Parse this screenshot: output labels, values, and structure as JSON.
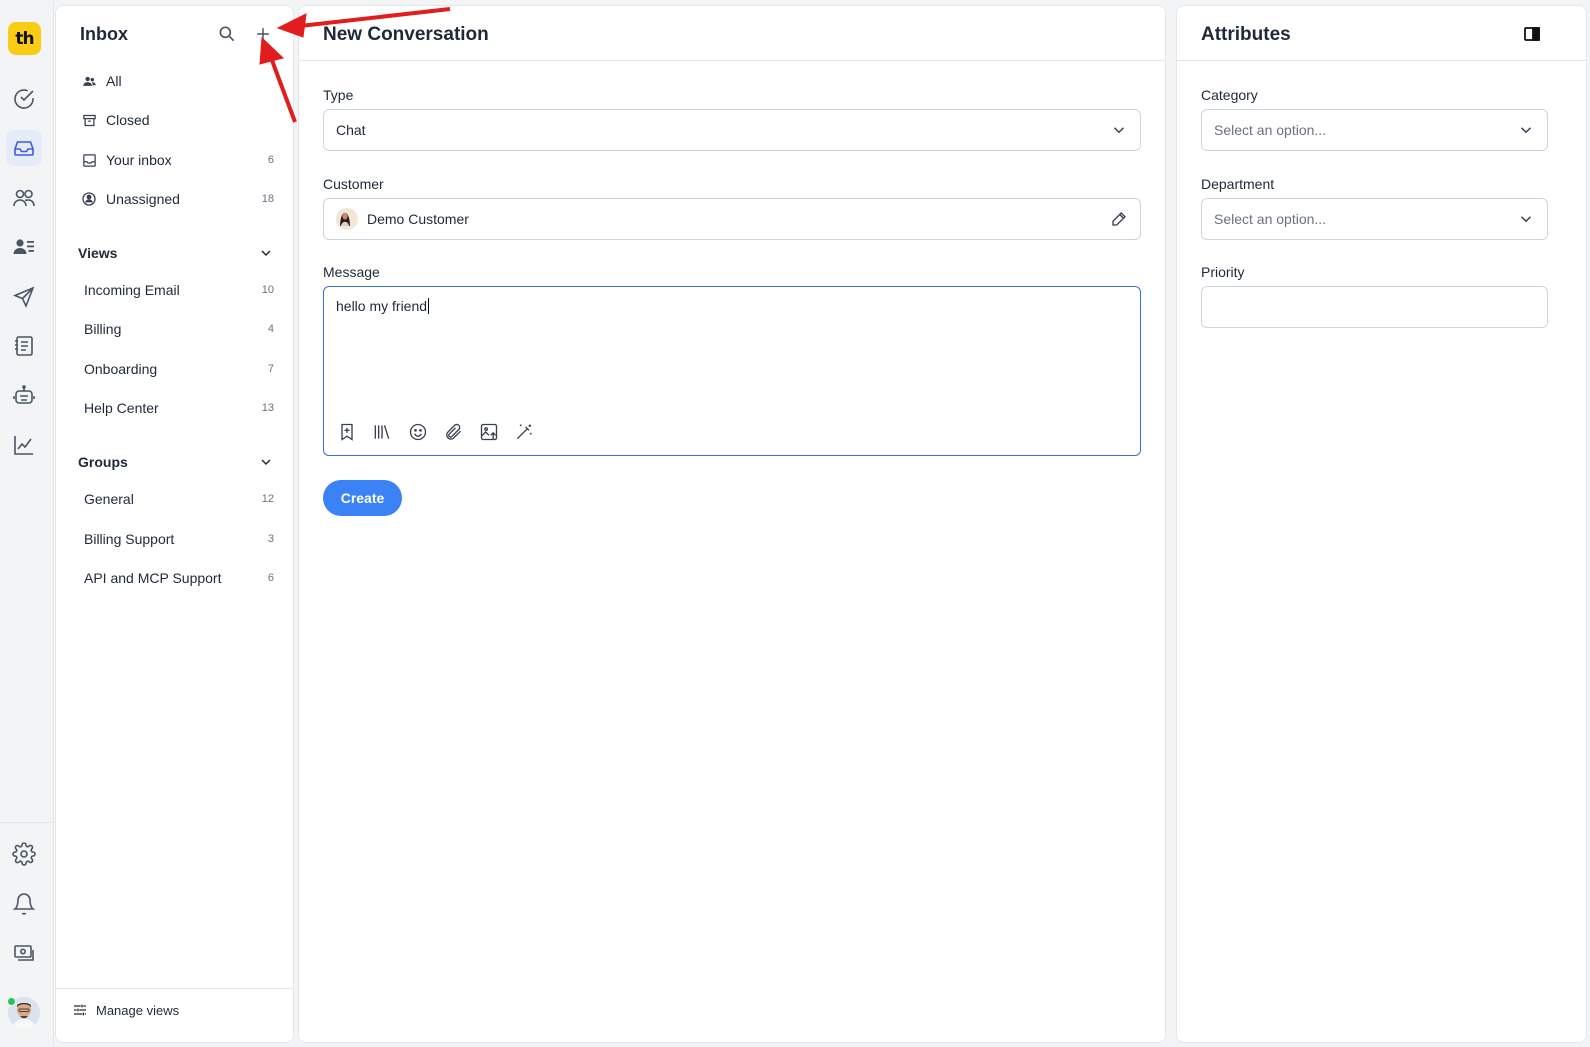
{
  "rail": {
    "logo_text": "th",
    "icons": [
      "check-circle-icon",
      "inbox-icon",
      "users-icon",
      "contacts-icon",
      "send-icon",
      "knowledge-base-icon",
      "bot-icon",
      "reports-icon",
      "settings-icon",
      "bell-icon",
      "billing-icon"
    ],
    "active": "inbox-icon"
  },
  "inbox": {
    "title": "Inbox",
    "items": [
      {
        "label": "All",
        "count": "",
        "icon": "people-icon"
      },
      {
        "label": "Closed",
        "count": "",
        "icon": "archive-icon"
      },
      {
        "label": "Your inbox",
        "count": "6",
        "icon": "tray-icon"
      },
      {
        "label": "Unassigned",
        "count": "18",
        "icon": "unassigned-icon"
      }
    ],
    "views": {
      "title": "Views",
      "items": [
        {
          "label": "Incoming Email",
          "count": "10"
        },
        {
          "label": "Billing",
          "count": "4"
        },
        {
          "label": "Onboarding",
          "count": "7"
        },
        {
          "label": "Help Center",
          "count": "13"
        }
      ]
    },
    "groups": {
      "title": "Groups",
      "items": [
        {
          "label": "General",
          "count": "12"
        },
        {
          "label": "Billing Support",
          "count": "3"
        },
        {
          "label": "API and MCP Support",
          "count": "6"
        }
      ]
    },
    "footer_label": "Manage views"
  },
  "main": {
    "title": "New Conversation",
    "type_label": "Type",
    "type_value": "Chat",
    "customer_label": "Customer",
    "customer_value": "Demo Customer",
    "message_label": "Message",
    "message_value": "hello my friend",
    "create_label": "Create"
  },
  "attributes": {
    "title": "Attributes",
    "category_label": "Category",
    "category_placeholder": "Select an option...",
    "department_label": "Department",
    "department_placeholder": "Select an option...",
    "priority_label": "Priority"
  },
  "colors": {
    "accent": "#3b82f6",
    "logo": "#facc15",
    "annotation": "#e11d1d"
  }
}
